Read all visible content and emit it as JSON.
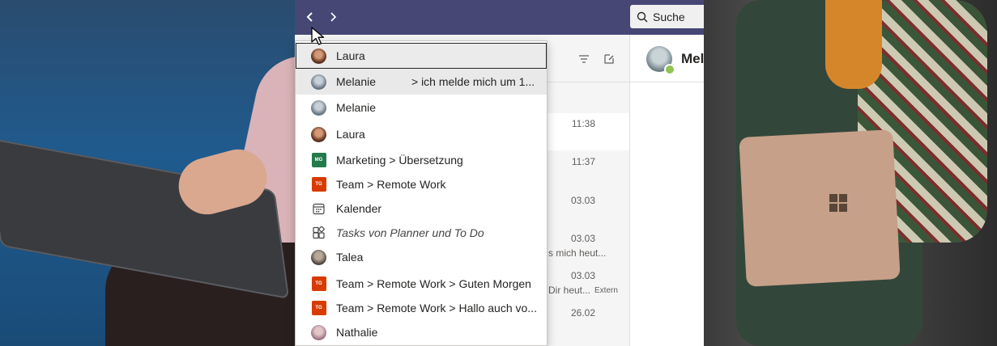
{
  "titlebar": {
    "back_icon": "chevron-left-icon",
    "forward_icon": "chevron-right-icon",
    "search_placeholder": "Suche",
    "color": "#464775"
  },
  "chat_list": {
    "rows": [
      {
        "time": "11:38",
        "preview": "",
        "badge": ""
      },
      {
        "time": "11:37",
        "preview": "",
        "badge": ""
      },
      {
        "time": "03.03",
        "preview": "",
        "badge": ""
      },
      {
        "time": "03.03",
        "preview": "s mich heut...",
        "badge": ""
      },
      {
        "time": "03.03",
        "preview": "Dir heut...",
        "badge": "Extern"
      },
      {
        "time": "26.02",
        "preview": "",
        "badge": ""
      }
    ]
  },
  "chat_pane": {
    "name": "Mel"
  },
  "history": {
    "items": [
      {
        "label": "Laura",
        "icon": "avatar",
        "state": "focused"
      },
      {
        "label": "Melanie",
        "extra": "> ich melde mich um 1...",
        "icon": "avatar",
        "state": "hover"
      },
      {
        "label": "Melanie",
        "icon": "avatar"
      },
      {
        "label": "Laura",
        "icon": "avatar"
      },
      {
        "label": "Marketing > Übersetzung",
        "icon": "team-tile",
        "tile_text": "MG"
      },
      {
        "label": "Team > Remote Work",
        "icon": "team-tile",
        "tile_text": "TG"
      },
      {
        "label": "Kalender",
        "icon": "calendar-icon"
      },
      {
        "label": "Tasks von Planner und To Do",
        "icon": "tasks-app-icon"
      },
      {
        "label": "Talea",
        "icon": "avatar"
      },
      {
        "label": "Team > Remote Work > Guten Morgen",
        "icon": "team-tile",
        "tile_text": "TG"
      },
      {
        "label": "Team > Remote Work > Hallo auch vo...",
        "icon": "team-tile",
        "tile_text": "TG"
      },
      {
        "label": "Nathalie",
        "icon": "avatar"
      }
    ]
  }
}
